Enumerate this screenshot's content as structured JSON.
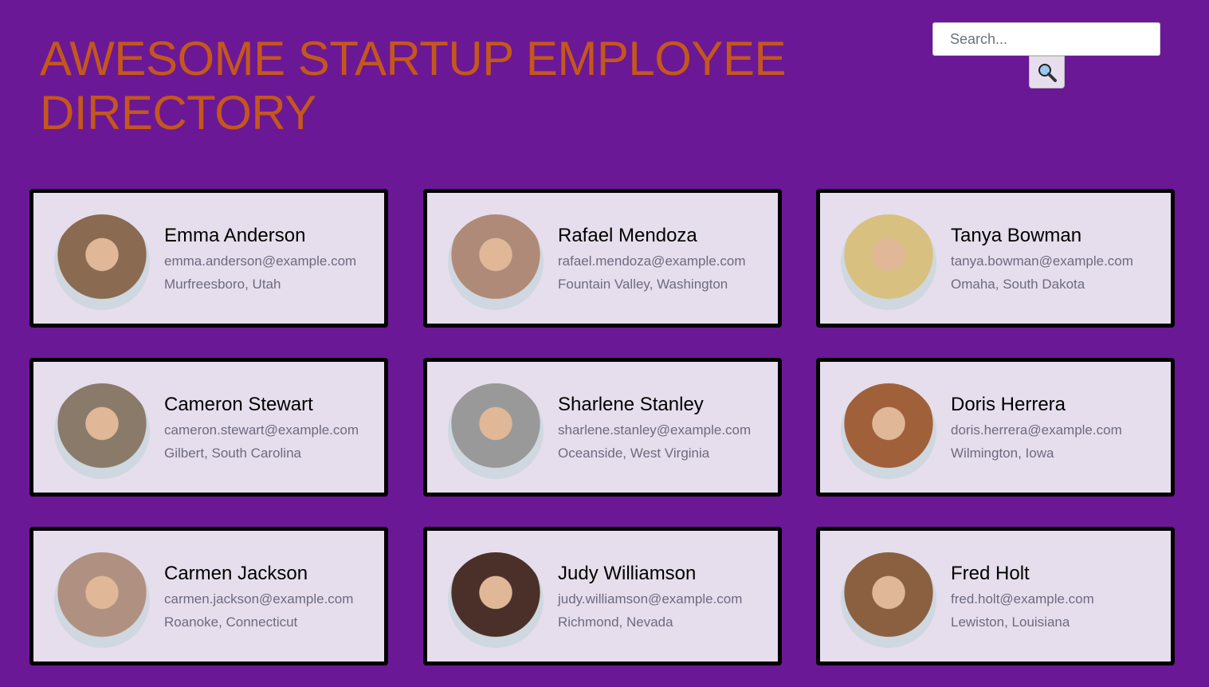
{
  "header": {
    "title": "AWESOME STARTUP EMPLOYEE DIRECTORY"
  },
  "search": {
    "placeholder": "Search...",
    "button_icon": "magnifying-glass-icon"
  },
  "employees": [
    {
      "name": "Emma Anderson",
      "email": "emma.anderson@example.com",
      "location": "Murfreesboro, Utah",
      "color": "#8a6a50"
    },
    {
      "name": "Rafael Mendoza",
      "email": "rafael.mendoza@example.com",
      "location": "Fountain Valley, Washington",
      "color": "#b08a78"
    },
    {
      "name": "Tanya Bowman",
      "email": "tanya.bowman@example.com",
      "location": "Omaha, South Dakota",
      "color": "#d8c080"
    },
    {
      "name": "Cameron Stewart",
      "email": "cameron.stewart@example.com",
      "location": "Gilbert, South Carolina",
      "color": "#8a7a6a"
    },
    {
      "name": "Sharlene Stanley",
      "email": "sharlene.stanley@example.com",
      "location": "Oceanside, West Virginia",
      "color": "#999999"
    },
    {
      "name": "Doris Herrera",
      "email": "doris.herrera@example.com",
      "location": "Wilmington, Iowa",
      "color": "#a0603a"
    },
    {
      "name": "Carmen Jackson",
      "email": "carmen.jackson@example.com",
      "location": "Roanoke, Connecticut",
      "color": "#b09080"
    },
    {
      "name": "Judy Williamson",
      "email": "judy.williamson@example.com",
      "location": "Richmond, Nevada",
      "color": "#4a3028"
    },
    {
      "name": "Fred Holt",
      "email": "fred.holt@example.com",
      "location": "Lewiston, Louisiana",
      "color": "#8a6040"
    }
  ]
}
